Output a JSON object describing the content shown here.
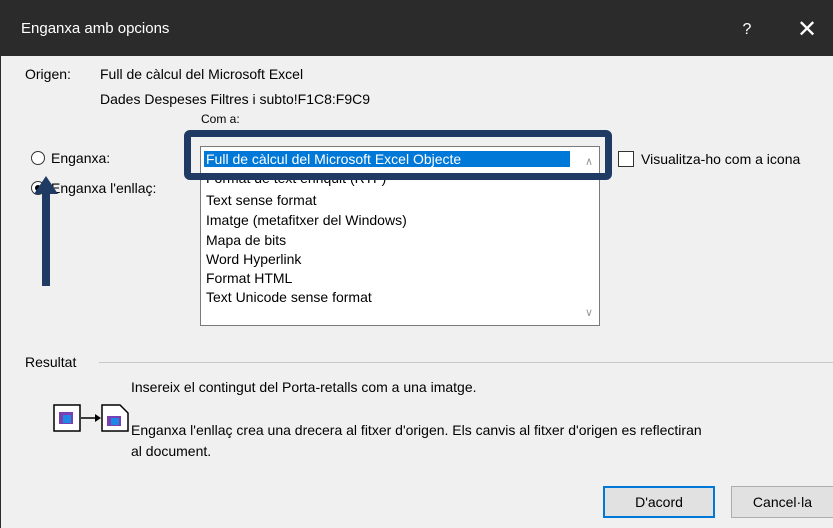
{
  "window": {
    "title": "Enganxa amb opcions",
    "help": "?",
    "close": "✕"
  },
  "origin": {
    "label": "Origen:",
    "line1": "Full de càlcul del Microsoft Excel",
    "line2": "Dades Despeses Filtres i subto!F1C8:F9C9"
  },
  "as_label": "Com a:",
  "radios": {
    "paste": "Enganxa:",
    "paste_link": "Enganxa l'enllaç:"
  },
  "list": {
    "items": [
      "Full de càlcul del Microsoft Excel Objecte",
      "Format de text enriquit (RTF)",
      "Text sense format",
      "Imatge (metafitxer del Windows)",
      "Mapa de bits",
      "Word Hyperlink",
      "Format HTML",
      "Text Unicode sense format"
    ],
    "selected_index": 0
  },
  "display_as_icon": "Visualitza-ho com a icona",
  "result": {
    "label": "Resultat",
    "text1": "Insereix el contingut del Porta-retalls com a una imatge.",
    "text2_line1": "Enganxa l'enllaç crea una drecera al fitxer d'origen. Els canvis al fitxer d'origen es reflectiran",
    "text2_line2": "al document."
  },
  "buttons": {
    "ok": "D'acord",
    "cancel": "Cancel·la"
  },
  "colors": {
    "highlight": "#1f3b63",
    "selection": "#0078d7"
  }
}
